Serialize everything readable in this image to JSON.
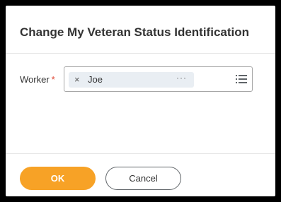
{
  "dialog": {
    "title": "Change My Veteran Status Identification"
  },
  "form": {
    "worker": {
      "label": "Worker",
      "required_marker": "*",
      "selected_item": {
        "remove_glyph": "×",
        "text": "Joe",
        "more_glyph": "···"
      },
      "list_icon": "prompt-list-icon"
    }
  },
  "actions": {
    "ok_label": "OK",
    "cancel_label": "Cancel"
  },
  "colors": {
    "primary_button": "#f7a226",
    "required": "#de4331",
    "pill_background": "#e9eef3"
  }
}
